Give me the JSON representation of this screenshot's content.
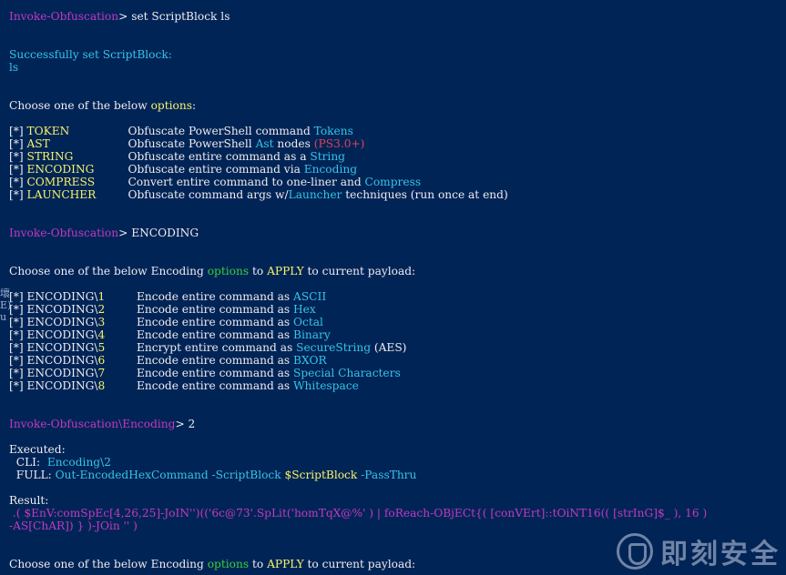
{
  "terminal": {
    "prompt1": "Invoke-Obfuscation",
    "cmd1": "set ScriptBlock ls",
    "success_msg": "Successfully set ScriptBlock:",
    "scriptblock_value": "ls",
    "choose_pre": "Choose one of the below ",
    "choose_options_word": "options",
    "choose_post": ":",
    "menu": [
      {
        "tag": "[*] ",
        "name": "TOKEN",
        "pre": "Obfuscate PowerShell command ",
        "hl": "Tokens",
        "post": "",
        "extra": ""
      },
      {
        "tag": "[*] ",
        "name": "AST",
        "pre": "Obfuscate PowerShell ",
        "hl": "Ast",
        "post": " nodes ",
        "extra": "(PS3.0+)"
      },
      {
        "tag": "[*] ",
        "name": "STRING",
        "pre": "Obfuscate entire command as a ",
        "hl": "String",
        "post": "",
        "extra": ""
      },
      {
        "tag": "[*] ",
        "name": "ENCODING",
        "pre": "Obfuscate entire command via ",
        "hl": "Encoding",
        "post": "",
        "extra": ""
      },
      {
        "tag": "[*] ",
        "name": "COMPRESS",
        "pre": "Convert entire command to one-liner and ",
        "hl": "Compress",
        "post": "",
        "extra": ""
      },
      {
        "tag": "[*] ",
        "name": "LAUNCHER",
        "pre": "Obfuscate command args w/",
        "hl": "Launcher",
        "post": " techniques (run once at end)",
        "extra": ""
      }
    ],
    "prompt2": "Invoke-Obfuscation",
    "cmd2": "ENCODING",
    "enc_choose_pre": "Choose one of the below Encoding ",
    "enc_choose_options": "options",
    "enc_choose_mid": " to ",
    "enc_choose_apply": "APPLY",
    "enc_choose_post": " to current payload:",
    "enc_menu": [
      {
        "prefix": "[*] ENCODING\\",
        "num": "1",
        "desc": "Encode entire command as ",
        "hl": "ASCII",
        "post": ""
      },
      {
        "prefix": "[*] ENCODING\\",
        "num": "2",
        "desc": "Encode entire command as ",
        "hl": "Hex",
        "post": ""
      },
      {
        "prefix": "[*] ENCODING\\",
        "num": "3",
        "desc": "Encode entire command as ",
        "hl": "Octal",
        "post": ""
      },
      {
        "prefix": "[*] ENCODING\\",
        "num": "4",
        "desc": "Encode entire command as ",
        "hl": "Binary",
        "post": ""
      },
      {
        "prefix": "[*] ENCODING\\",
        "num": "5",
        "desc": "Encrypt entire command as ",
        "hl": "SecureString",
        "post": " (AES)"
      },
      {
        "prefix": "[*] ENCODING\\",
        "num": "6",
        "desc": "Encode entire command as ",
        "hl": "BXOR",
        "post": ""
      },
      {
        "prefix": "[*] ENCODING\\",
        "num": "7",
        "desc": "Encode entire command as ",
        "hl": "Special Characters",
        "post": ""
      },
      {
        "prefix": "[*] ENCODING\\",
        "num": "8",
        "desc": "Encode entire command as ",
        "hl": "Whitespace",
        "post": ""
      }
    ],
    "prompt3": "Invoke-Obfuscation\\Encoding",
    "cmd3": "2",
    "executed_label": "Executed:",
    "cli_label": "  CLI:  ",
    "cli_value": "Encoding\\2",
    "full_label": "  FULL: ",
    "full_cmd": "Out-EncodedHexCommand -ScriptBlock ",
    "full_var": "$ScriptBlock",
    "full_rest": " -PassThru",
    "result_label": "Result:",
    "result_line1": " .( $EnV:comSpEc[4,26,25]-JoIN'')(('6c@73'.SpLit('homTqX@%' ) | foReach-OBjECt{( [conVErt]::tOiNT16(( [strInG]$_ ), 16 )",
    "result_line2": "-AS[ChAR]) } )-JOin '' )",
    "final_choose_pre": "Choose one of the below Encoding ",
    "final_choose_options": "options",
    "final_choose_mid": " to ",
    "final_choose_apply": "APPLY",
    "final_choose_post": " to current payload:"
  },
  "sidebar_fragments": [
    "壞",
    "E)",
    "u"
  ],
  "watermark": {
    "text": "即刻安全",
    "icon": "shield-logo-icon"
  },
  "colors": {
    "background": "#012456",
    "prompt": "#c239c2",
    "cyan": "#36c4e8",
    "yellow": "#f4f46c",
    "green": "#3bd03b",
    "red": "#e0405a"
  }
}
